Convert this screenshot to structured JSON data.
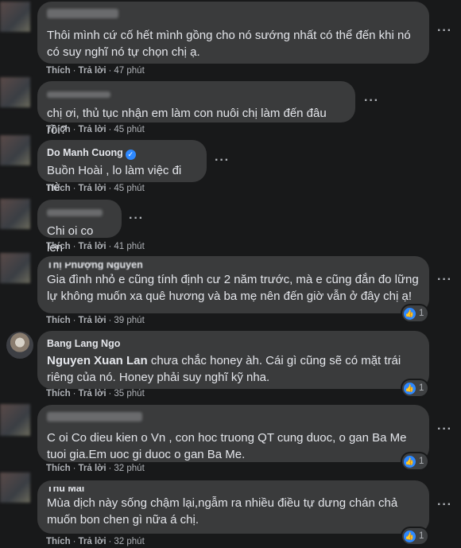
{
  "labels": {
    "like": "Thích",
    "reply": "Trả lời"
  },
  "comments": [
    {
      "name": "",
      "text": "Thôi mình cứ cố hết mình gồng cho nó sướng nhất có thể đến khi nó có suy nghĩ nó tự chọn chị ạ.",
      "time": "47 phút"
    },
    {
      "name": "",
      "text": "chị ơi, thủ tục nhận em làm con nuôi chị làm đến đâu rồi?",
      "time": "45 phút"
    },
    {
      "name": "Do Manh Cuong",
      "text": "Buồn Hoài , lo làm việc đi nè",
      "time": "45 phút"
    },
    {
      "name": "",
      "text": "Chi oi co len",
      "time": "41 phút"
    },
    {
      "name": "Thị Phượng Nguyễn",
      "text": "Gia đình nhỏ e cũng tính định cư 2 năm trước, mà e cũng đắn đo lững lự không muốn xa quê hương và ba mẹ nên đến giờ vẫn ở đây chị ạ!",
      "time": "39 phút",
      "reactions": "1"
    },
    {
      "name": "Bang Lang Ngo",
      "mention": "Nguyen Xuan Lan",
      "text": " chưa chắc honey àh. Cái gì cũng sẽ có mặt trái riêng của nó. Honey phải suy nghĩ kỹ nha.",
      "time": "35 phút",
      "reactions": "1"
    },
    {
      "name": "",
      "text": "C oi Co dieu kien o Vn , con hoc truong QT cung duoc, o gan Ba Me tuoi gia.Em uoc gi duoc o gan Ba Me.",
      "time": "32 phút",
      "reactions": "1"
    },
    {
      "name": "Thu Mai",
      "text": "Mùa dịch này sống chậm lại,ngẫm ra nhiều điều tự dưng chán chả muốn bon chen gì nữa á chị.",
      "time": "32 phút",
      "reactions": "1"
    }
  ]
}
